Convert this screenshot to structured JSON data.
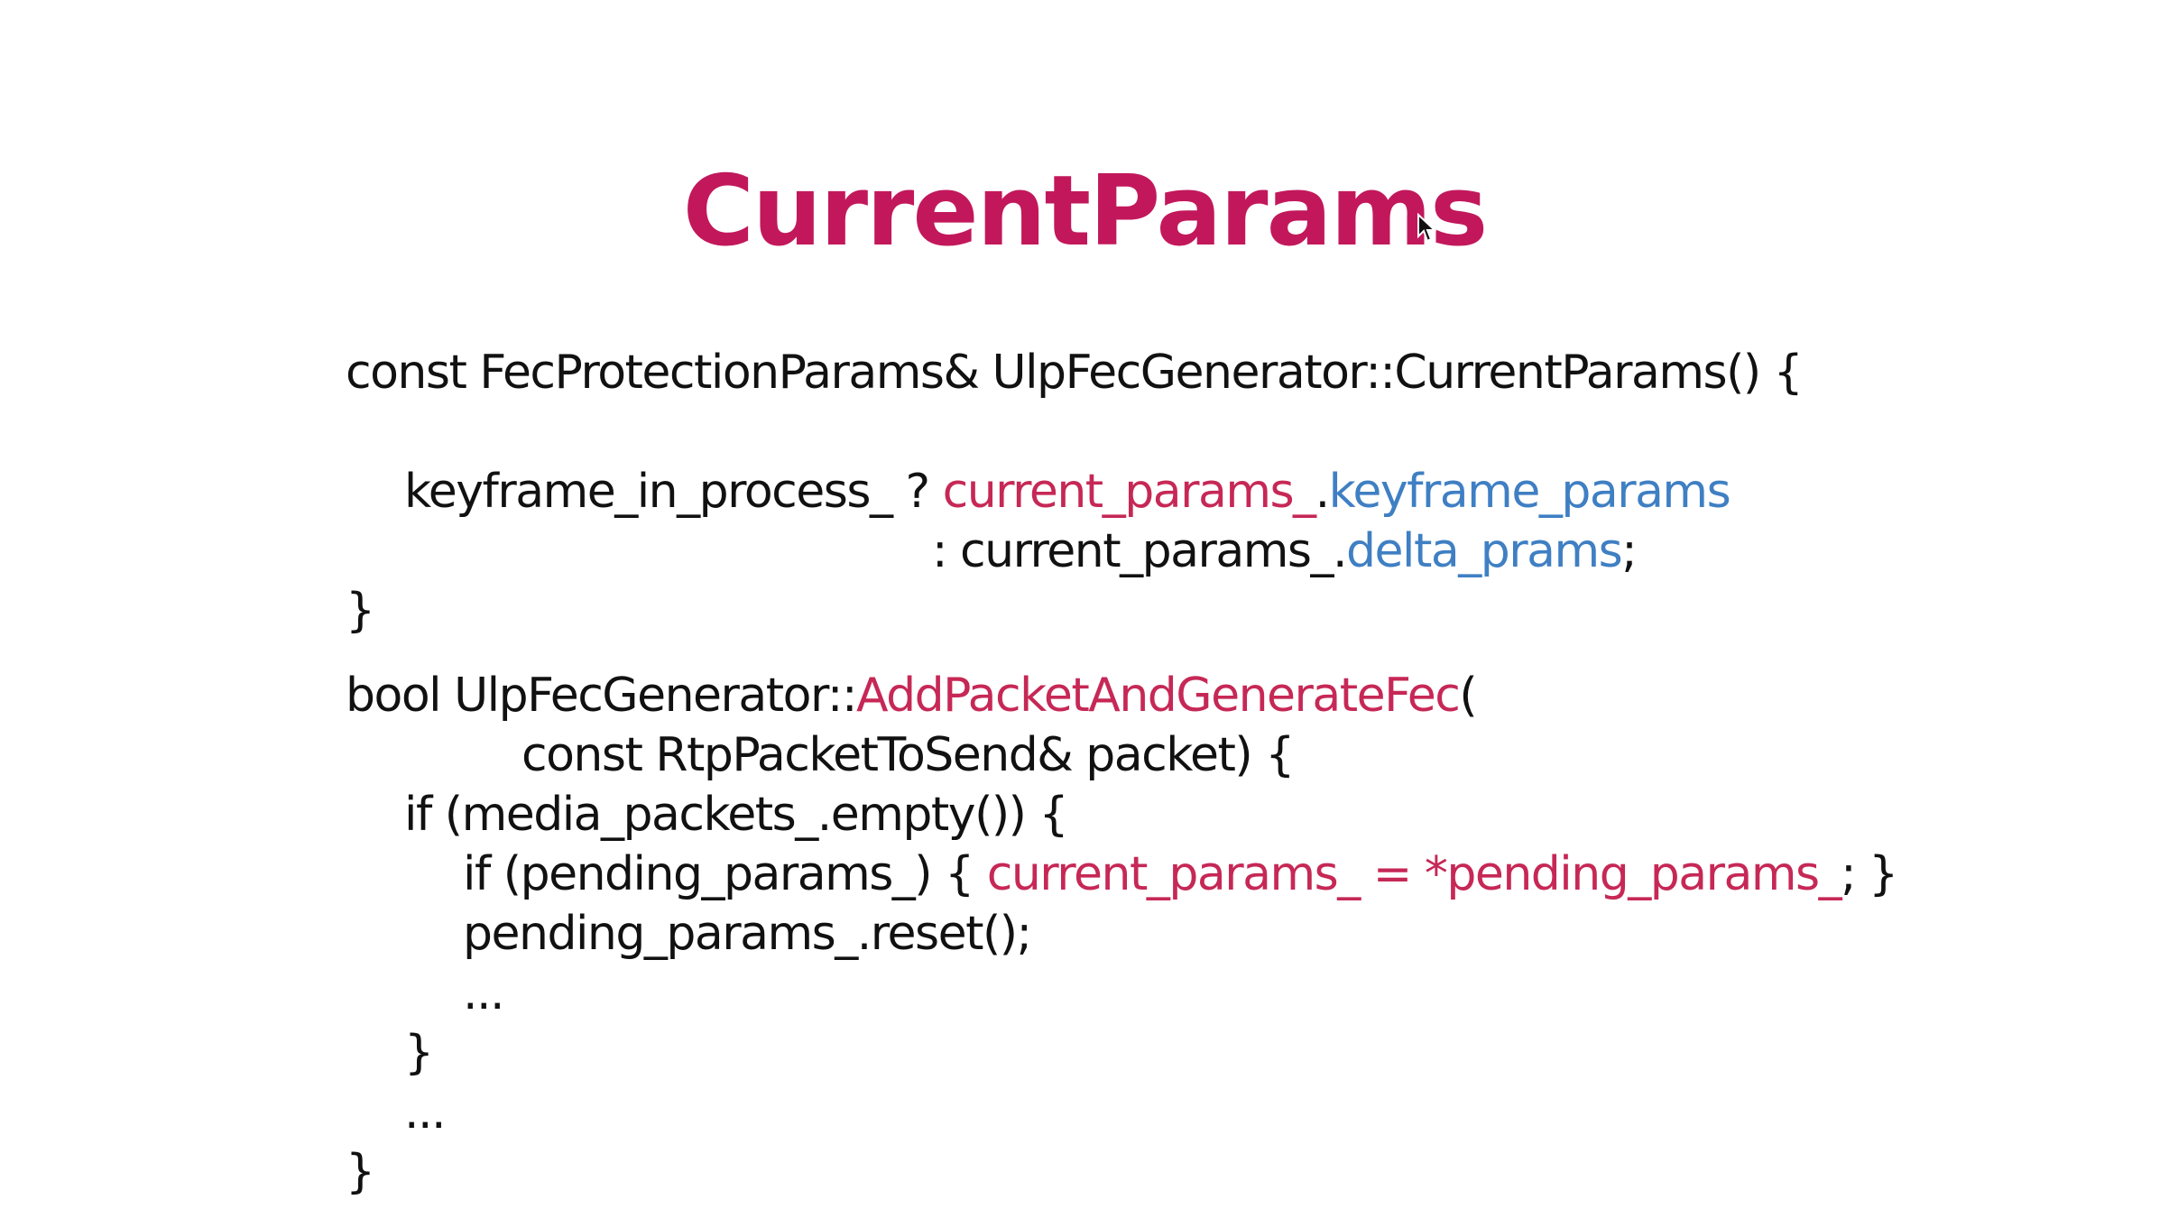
{
  "slide": {
    "title": "CurrentParams",
    "title_color": "#C2185B",
    "colors": {
      "default": "#111111",
      "red": "#C62856",
      "blue": "#3F7FC3"
    }
  },
  "code_lines": [
    {
      "indent": 0,
      "tokens": [
        {
          "text": "const FecProtectionParams& UlpFecGenerator::CurrentParams() {",
          "color": "default"
        }
      ]
    },
    {
      "indent": 0,
      "tokens": [
        {
          "text": "",
          "color": "default"
        }
      ]
    },
    {
      "indent": 1,
      "tokens": [
        {
          "text": "keyframe_in_process_ ? ",
          "color": "default"
        },
        {
          "text": "current_params_",
          "color": "red"
        },
        {
          "text": ".",
          "color": "default"
        },
        {
          "text": "keyframe_params",
          "color": "blue"
        }
      ]
    },
    {
      "indent": 10,
      "tokens": [
        {
          "text": ": current_params_.",
          "color": "default"
        },
        {
          "text": "delta_prams",
          "color": "blue"
        },
        {
          "text": ";",
          "color": "default"
        }
      ]
    },
    {
      "indent": 0,
      "tokens": [
        {
          "text": "}",
          "color": "default"
        }
      ]
    },
    {
      "indent": 0,
      "gap": true,
      "tokens": [
        {
          "text": "bool UlpFecGenerator::",
          "color": "default"
        },
        {
          "text": "AddPacketAndGenerateFec",
          "color": "red"
        },
        {
          "text": "(",
          "color": "default"
        }
      ]
    },
    {
      "indent": 3,
      "tokens": [
        {
          "text": "const RtpPacketToSend& packet) {",
          "color": "default"
        }
      ]
    },
    {
      "indent": 1,
      "tokens": [
        {
          "text": "if (media_packets_.empty()) {",
          "color": "default"
        }
      ]
    },
    {
      "indent": 2,
      "tokens": [
        {
          "text": "if (pending_params_) { ",
          "color": "default"
        },
        {
          "text": "current_params_ = *pending_params_",
          "color": "red"
        },
        {
          "text": "; }",
          "color": "default"
        }
      ]
    },
    {
      "indent": 2,
      "tokens": [
        {
          "text": "pending_params_.reset();",
          "color": "default"
        }
      ]
    },
    {
      "indent": 2,
      "tokens": [
        {
          "text": "...",
          "color": "default"
        }
      ]
    },
    {
      "indent": 1,
      "tokens": [
        {
          "text": "}",
          "color": "default"
        }
      ]
    },
    {
      "indent": 1,
      "tokens": [
        {
          "text": "...",
          "color": "default"
        }
      ]
    },
    {
      "indent": 0,
      "tokens": [
        {
          "text": "}",
          "color": "default"
        }
      ]
    }
  ],
  "cursor": {
    "icon": "mouse-pointer-icon"
  }
}
